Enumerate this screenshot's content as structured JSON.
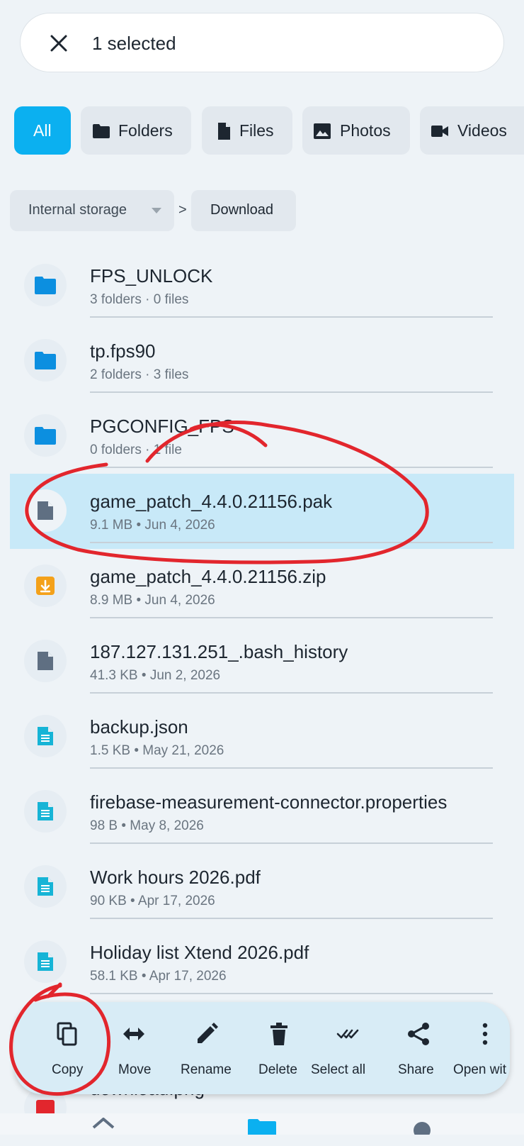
{
  "header": {
    "title": "1 selected",
    "close_icon": "close-icon"
  },
  "filters": [
    {
      "label": "All",
      "active": true
    },
    {
      "label": "Folders",
      "icon": "folder-icon"
    },
    {
      "label": "Files",
      "icon": "file-icon"
    },
    {
      "label": "Photos",
      "icon": "photo-icon"
    },
    {
      "label": "Videos",
      "icon": "video-icon"
    }
  ],
  "breadcrumb": {
    "root": "Internal storage",
    "separator": ">",
    "current": "Download"
  },
  "items": [
    {
      "name": "FPS_UNLOCK",
      "meta": "3 folders · 0 files",
      "type": "folder"
    },
    {
      "name": "tp.fps90",
      "meta": "2 folders · 3 files",
      "type": "folder"
    },
    {
      "name": "PGCONFIG_FPS",
      "meta": "0 folders · 1 file",
      "type": "folder"
    },
    {
      "name": "game_patch_4.4.0.21156.pak",
      "meta": "9.1 MB • Jun 4, 2026",
      "type": "file",
      "selected": true
    },
    {
      "name": "game_patch_4.4.0.21156.zip",
      "meta": "8.9 MB • Jun 4, 2026",
      "type": "archive"
    },
    {
      "name": "187.127.131.251_.bash_history",
      "meta": "41.3 KB • Jun 2, 2026",
      "type": "file"
    },
    {
      "name": "backup.json",
      "meta": "1.5 KB • May 21, 2026",
      "type": "doc"
    },
    {
      "name": "firebase-measurement-connector.properties",
      "meta": "98 B • May 8, 2026",
      "type": "doc"
    },
    {
      "name": "Work hours 2026.pdf",
      "meta": "90 KB • Apr 17, 2026",
      "type": "doc"
    },
    {
      "name": "Holiday list Xtend 2026.pdf",
      "meta": "58.1 KB • Apr 17, 2026",
      "type": "doc"
    },
    {
      "name": "download.png",
      "meta": "",
      "type": "image"
    }
  ],
  "actions": [
    {
      "label": "Copy",
      "icon": "copy-icon"
    },
    {
      "label": "Move",
      "icon": "move-icon"
    },
    {
      "label": "Rename",
      "icon": "edit-icon"
    },
    {
      "label": "Delete",
      "icon": "delete-icon"
    },
    {
      "label": "Select all",
      "icon": "select-all-icon"
    },
    {
      "label": "Share",
      "icon": "share-icon"
    },
    {
      "label": "Open wit",
      "icon": "more-vert-icon"
    }
  ],
  "colors": {
    "accent": "#0bb0f0",
    "folder": "#0c8fe0",
    "selected_row": "#c8e9f8",
    "annotation": "#e2262d"
  }
}
